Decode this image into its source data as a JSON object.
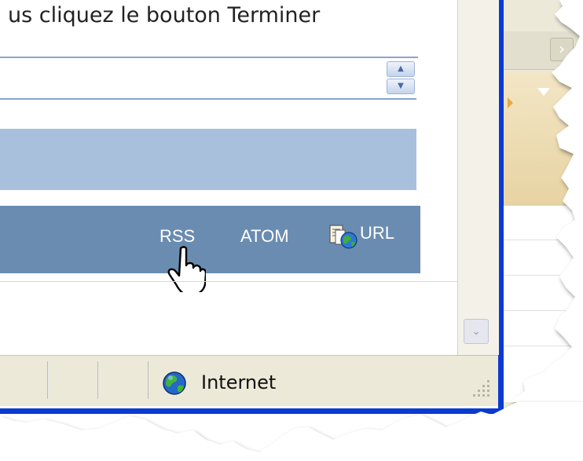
{
  "page": {
    "instruction_text": "us cliquez le bouton Terminer"
  },
  "feed_links": {
    "rss": "RSS",
    "atom": "ATOM",
    "url": "URL"
  },
  "statusbar": {
    "zone_label": "Internet"
  },
  "icons": {
    "url": "document-globe-icon",
    "zone": "globe-icon",
    "cursor": "hand-pointer-icon"
  },
  "colors": {
    "window_border": "#0b3ad1",
    "feed_bar": "#6a8cb1",
    "light_band": "#a9c0dc",
    "statusbar": "#ece9d8"
  }
}
